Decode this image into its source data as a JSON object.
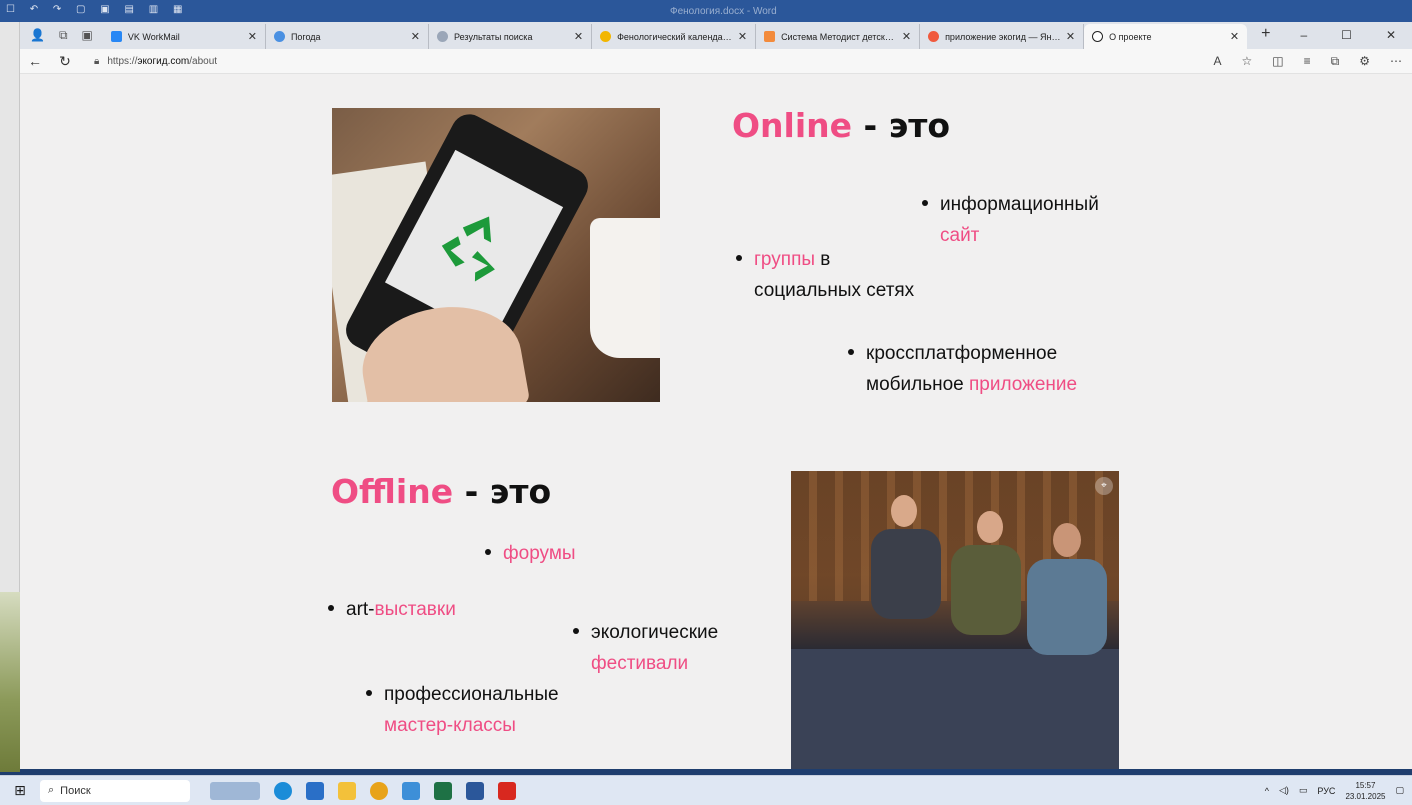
{
  "word": {
    "doc_title": "Фенология.docx - Word"
  },
  "browser": {
    "tabs": [
      {
        "label": "VK WorkMail",
        "color": "#2787f5"
      },
      {
        "label": "Погода",
        "color": "#4a90e2"
      },
      {
        "label": "Результаты поиска",
        "color": "#9aa6b8"
      },
      {
        "label": "Фенологический календарь д",
        "color": "#f2b600"
      },
      {
        "label": "Система Методист детского с",
        "color": "#f38b3c"
      },
      {
        "label": "приложение экогид — Яндекс",
        "color": "#f05a3e"
      },
      {
        "label": "О проекте",
        "color": "#222222"
      }
    ],
    "url_prefix": "https://",
    "url_host": "экогид.com",
    "url_path": "/about"
  },
  "online": {
    "word": "Online",
    "suffix": " - это",
    "items": [
      {
        "pre": "",
        "line1": "информационный",
        "pink2": "сайт"
      },
      {
        "pink1": "группы",
        "rest1": " в",
        "line2": "социальных сетях"
      },
      {
        "line1": "кроссплатформенное",
        "pre2": "мобильное ",
        "pink2": "приложение"
      }
    ]
  },
  "offline": {
    "word": "Offline",
    "suffix": " - это",
    "items": [
      {
        "pink1": "форумы"
      },
      {
        "pre1": "art-",
        "pink1": "выставки"
      },
      {
        "line1": "экологические",
        "pink2": "фестивали"
      },
      {
        "line1": "профессиональные",
        "pink2": "мастер-классы"
      }
    ]
  },
  "colors": {
    "accent": "#ef4d84"
  },
  "taskbar": {
    "search_label": "Поиск",
    "lang": "РУС",
    "time": "15:57",
    "date": "23.01.2025"
  }
}
